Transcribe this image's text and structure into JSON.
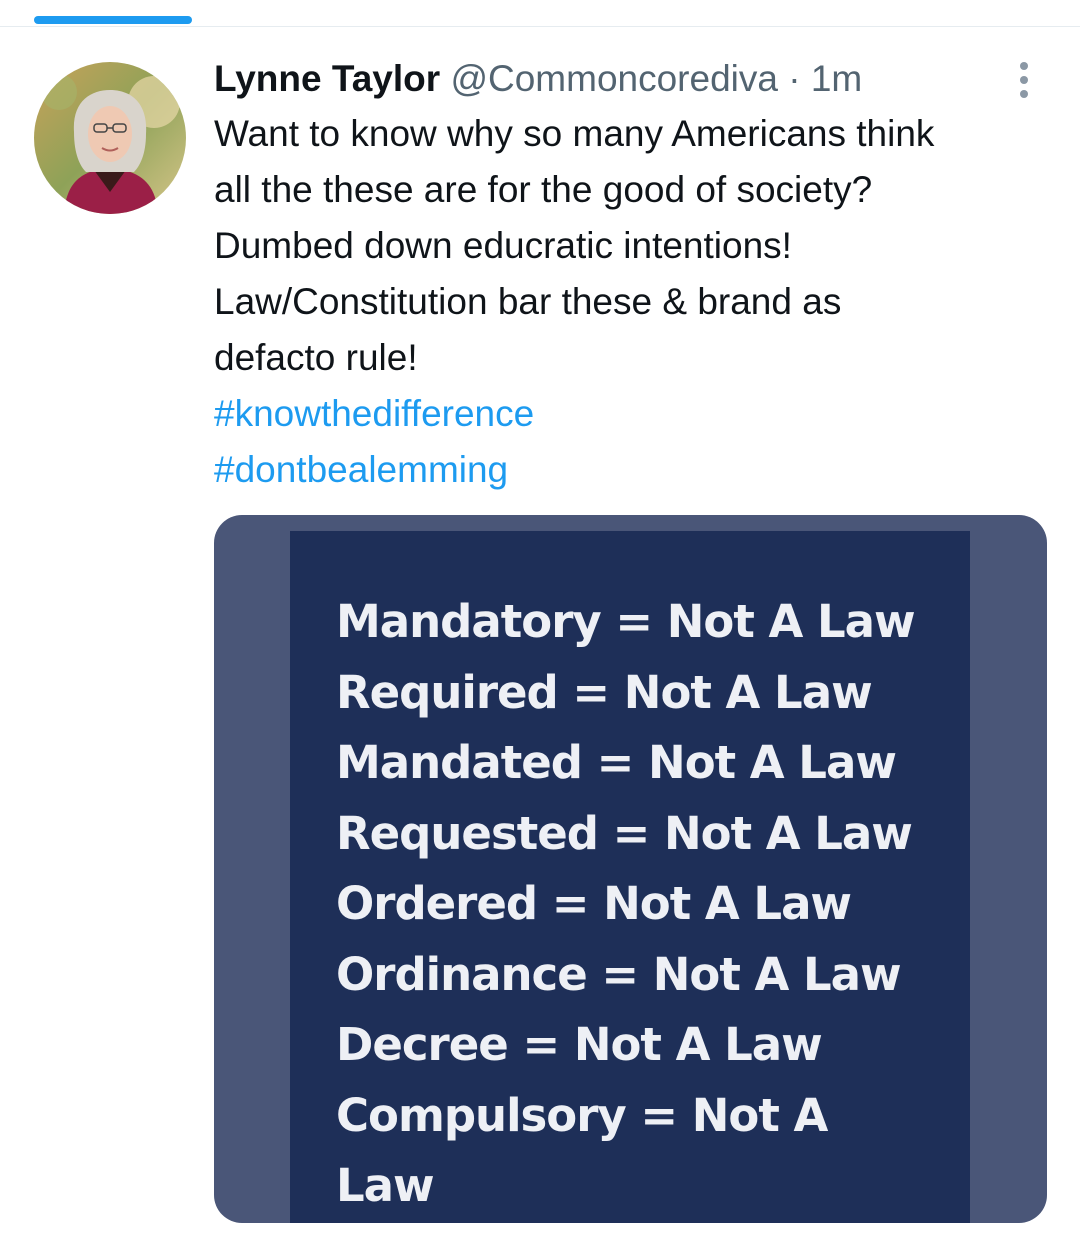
{
  "tweet": {
    "author": {
      "display_name": "Lynne Taylor",
      "handle": "@Commoncorediva",
      "separator": "·",
      "timestamp": "1m"
    },
    "text_lines": [
      "Want to know why so many Americans think",
      "all the these are for the good of society?",
      "Dumbed down educratic intentions!",
      "Law/Constitution bar these & brand as",
      "defacto rule!"
    ],
    "hashtags": [
      "#knowthedifference",
      "#dontbealemming"
    ],
    "media": {
      "lines": [
        "Mandatory = Not A Law",
        "Required = Not A Law",
        "Mandated = Not A Law",
        "Requested = Not A Law",
        "Ordered = Not A Law",
        "Ordinance = Not A Law",
        "Decree = Not A Law",
        "Compulsory = Not A",
        "Law"
      ]
    },
    "icons": {
      "more": "more-options-icon",
      "avatar": "avatar"
    }
  },
  "colors": {
    "accent": "#1d9bf0",
    "secondary_text": "#536471",
    "media_border": "#4a5678",
    "media_panel": "#1e2f58"
  }
}
